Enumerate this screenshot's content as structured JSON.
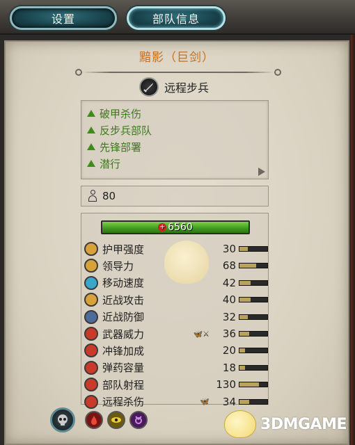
{
  "tabs": {
    "settings": "设置",
    "unit_info": "部队信息"
  },
  "unit": {
    "name": "黯影（巨剑）",
    "type": "远程步兵",
    "type_icon": "sword-icon",
    "men": "80"
  },
  "abilities": [
    "破甲杀伤",
    "反步兵部队",
    "先锋部署",
    "潜行"
  ],
  "health": "6560",
  "stats": [
    {
      "label": "护甲强度",
      "value": "30",
      "icon": "armor-icon",
      "color": "#d8a23a",
      "fill": 0.3
    },
    {
      "label": "领导力",
      "value": "68",
      "icon": "leadership-icon",
      "color": "#d8a23a",
      "fill": 0.6
    },
    {
      "label": "移动速度",
      "value": "42",
      "icon": "speed-icon",
      "color": "#3aa7c9",
      "fill": 0.4
    },
    {
      "label": "近战攻击",
      "value": "40",
      "icon": "melee-attack-icon",
      "color": "#d8a23a",
      "fill": 0.4
    },
    {
      "label": "近战防御",
      "value": "32",
      "icon": "melee-defence-icon",
      "color": "#4f6b9a",
      "fill": 0.3
    },
    {
      "label": "武器威力",
      "value": "36",
      "extra": "🦋⚔",
      "icon": "weapon-strength-icon",
      "color": "#c93a2a",
      "fill": 0.35
    },
    {
      "label": "冲锋加成",
      "value": "20",
      "icon": "charge-bonus-icon",
      "color": "#c93a2a",
      "fill": 0.2
    },
    {
      "label": "弹药容量",
      "value": "18",
      "icon": "ammunition-icon",
      "color": "#c93a2a",
      "fill": 0.2
    },
    {
      "label": "部队射程",
      "value": "130",
      "icon": "range-icon",
      "color": "#c93a2a",
      "fill": 0.7
    },
    {
      "label": "远程杀伤",
      "value": "34",
      "extra": "🦋",
      "icon": "missile-damage-icon",
      "color": "#c93a2a",
      "fill": 0.35
    }
  ],
  "bottom_icons": [
    "faction-skull-icon",
    "blood-icon",
    "eye-icon",
    "slaanesh-icon"
  ],
  "watermark": "3DMGAME"
}
